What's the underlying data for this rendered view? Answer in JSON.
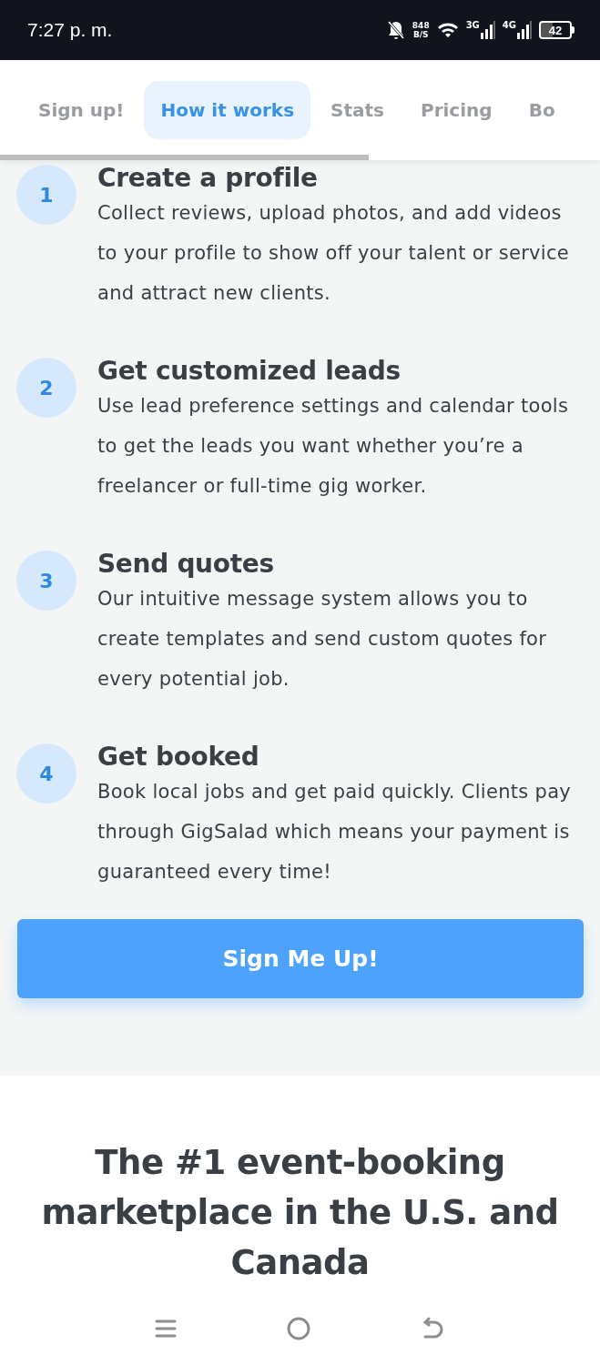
{
  "status_bar": {
    "time": "7:27 p. m.",
    "speed_value": "848",
    "speed_unit": "B/S",
    "network_3g": "3G",
    "network_4g": "4G",
    "battery": "42"
  },
  "tabs": [
    {
      "label": "Sign up!",
      "selected": false
    },
    {
      "label": "How it works",
      "selected": true
    },
    {
      "label": "Stats",
      "selected": false
    },
    {
      "label": "Pricing",
      "selected": false
    },
    {
      "label": "Bo",
      "selected": false
    }
  ],
  "steps": [
    {
      "number": "1",
      "title": "Create a profile",
      "description": "Collect reviews, upload photos, and add videos to your profile to show off your talent or service and attract new clients."
    },
    {
      "number": "2",
      "title": "Get customized leads",
      "description": "Use lead preference settings and calendar tools to get the leads you want whether you’re a freelancer or full-time gig worker."
    },
    {
      "number": "3",
      "title": "Send quotes",
      "description": "Our intuitive message system allows you to create templates and send custom quotes for every potential job."
    },
    {
      "number": "4",
      "title": "Get booked",
      "description": "Book local jobs and get paid quickly. Clients pay through GigSalad which means your payment is guaranteed every time!"
    }
  ],
  "cta_button": "Sign Me Up!",
  "heading": "The #1 event-booking marketplace in the U.S. and Canada"
}
